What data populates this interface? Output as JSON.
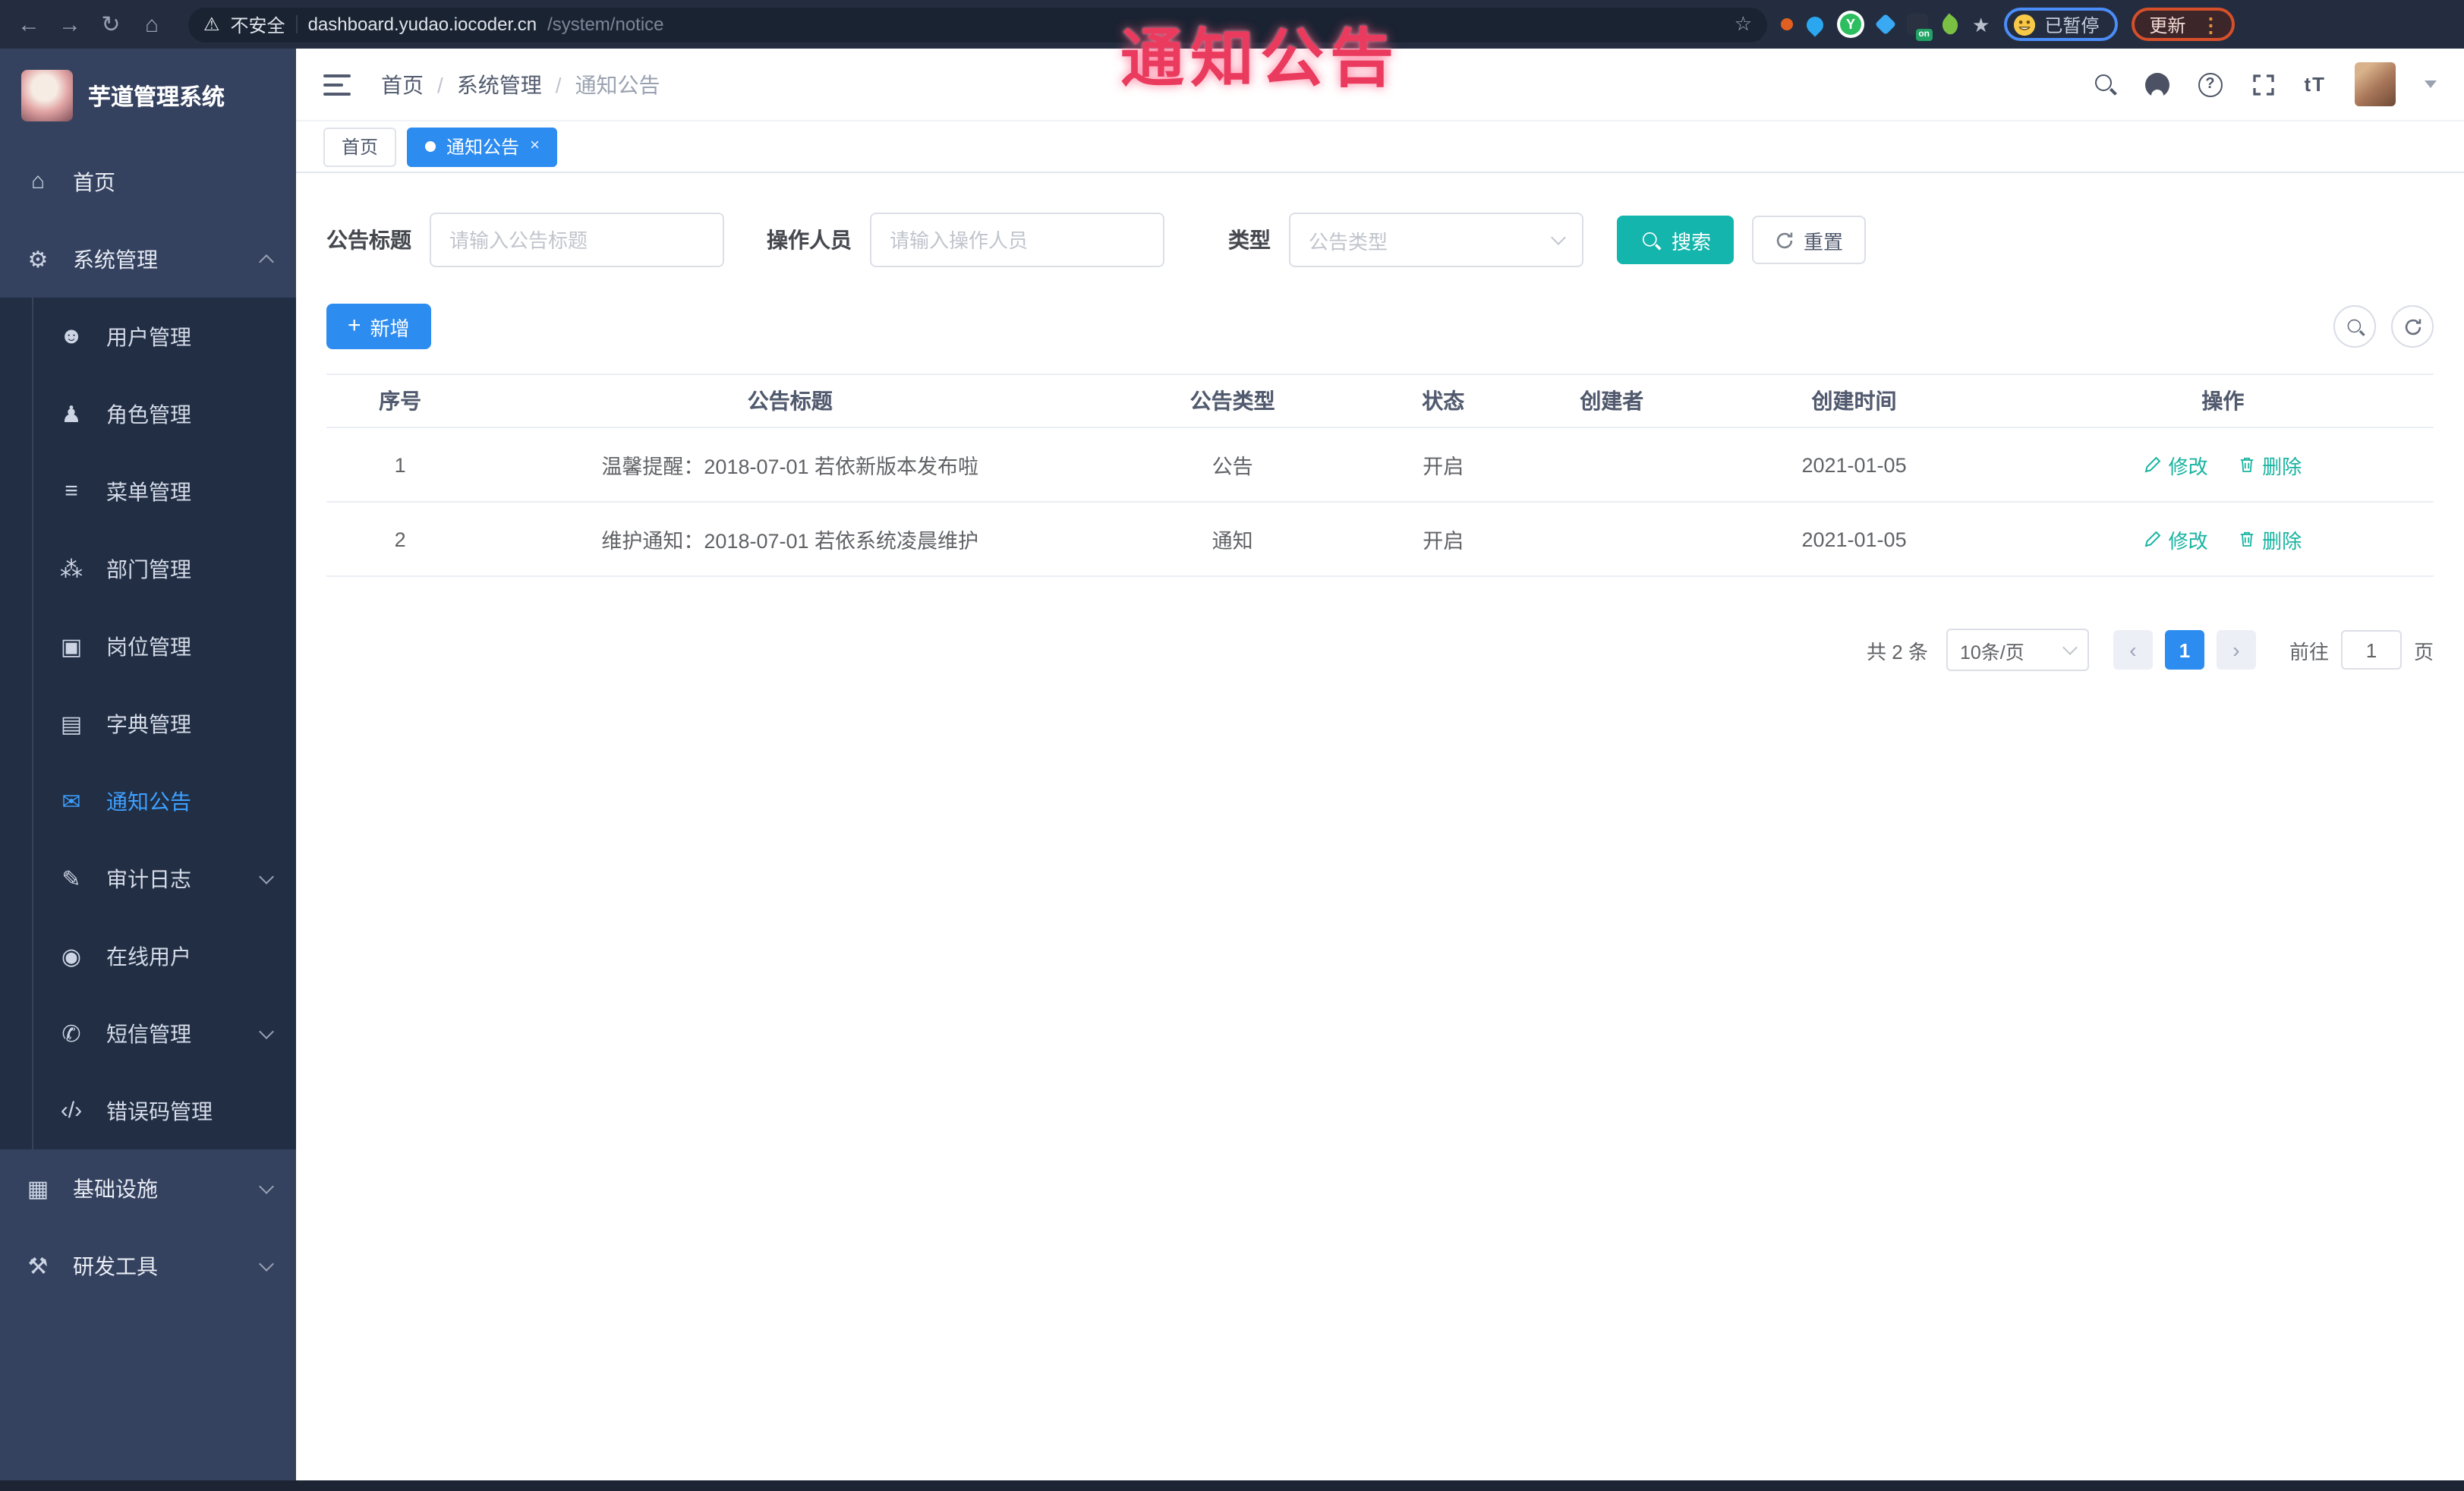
{
  "watermark": {
    "text": "通知公告",
    "color": "#ea3a5e"
  },
  "browser": {
    "insecure_label": "不安全",
    "url_host": "dashboard.yudao.iocoder.cn",
    "url_path": "/system/notice",
    "paused_label": "已暂停",
    "update_label": "更新",
    "on_badge": "on",
    "greeny_letter": "Y"
  },
  "sidebar": {
    "app_title": "芋道管理系统",
    "items": [
      {
        "label": "首页",
        "glyph": "⌂"
      },
      {
        "label": "系统管理",
        "glyph": "⚙"
      },
      {
        "label": "用户管理",
        "glyph": "☻"
      },
      {
        "label": "角色管理",
        "glyph": "♟"
      },
      {
        "label": "菜单管理",
        "glyph": "≡"
      },
      {
        "label": "部门管理",
        "glyph": "⁂"
      },
      {
        "label": "岗位管理",
        "glyph": "▣"
      },
      {
        "label": "字典管理",
        "glyph": "▤"
      },
      {
        "label": "通知公告",
        "glyph": "✉"
      },
      {
        "label": "审计日志",
        "glyph": "✎"
      },
      {
        "label": "在线用户",
        "glyph": "◉"
      },
      {
        "label": "短信管理",
        "glyph": "✆"
      },
      {
        "label": "错误码管理",
        "glyph": "‹/›"
      },
      {
        "label": "基础设施",
        "glyph": "▦"
      },
      {
        "label": "研发工具",
        "glyph": "⚒"
      }
    ]
  },
  "header": {
    "breadcrumb": {
      "home": "首页",
      "sep": "/",
      "section": "系统管理",
      "current": "通知公告"
    },
    "font_size_icon": "tT"
  },
  "tabs": {
    "home": "首页",
    "active": "通知公告",
    "close": "×"
  },
  "filters": {
    "title_label": "公告标题",
    "title_placeholder": "请输入公告标题",
    "operator_label": "操作人员",
    "operator_placeholder": "请输入操作人员",
    "type_label": "类型",
    "type_placeholder": "公告类型",
    "search_label": "搜索",
    "reset_label": "重置"
  },
  "toolbar": {
    "add_label": "新增"
  },
  "table": {
    "columns": [
      "序号",
      "公告标题",
      "公告类型",
      "状态",
      "创建者",
      "创建时间",
      "操作"
    ],
    "rows": [
      {
        "no": "1",
        "title": "温馨提醒：2018-07-01 若依新版本发布啦",
        "type": "公告",
        "status": "开启",
        "creator": "",
        "created": "2021-01-05"
      },
      {
        "no": "2",
        "title": "维护通知：2018-07-01 若依系统凌晨维护",
        "type": "通知",
        "status": "开启",
        "creator": "",
        "created": "2021-01-05"
      }
    ],
    "edit_label": "修改",
    "delete_label": "删除"
  },
  "pagination": {
    "total": "共 2 条",
    "page_size": "10条/页",
    "prev": "‹",
    "next": "›",
    "current": "1",
    "goto_label": "前往",
    "goto_value": "1",
    "page_unit": "页"
  },
  "colors": {
    "primary": "#2d8cf0",
    "search_button": "#13b5ac",
    "action_link": "#17b3a0",
    "sidebar_bg": "#35425f",
    "submenu_bg": "#212e44",
    "active_item": "#3da0ff",
    "watermark": "#ea3a5e"
  }
}
